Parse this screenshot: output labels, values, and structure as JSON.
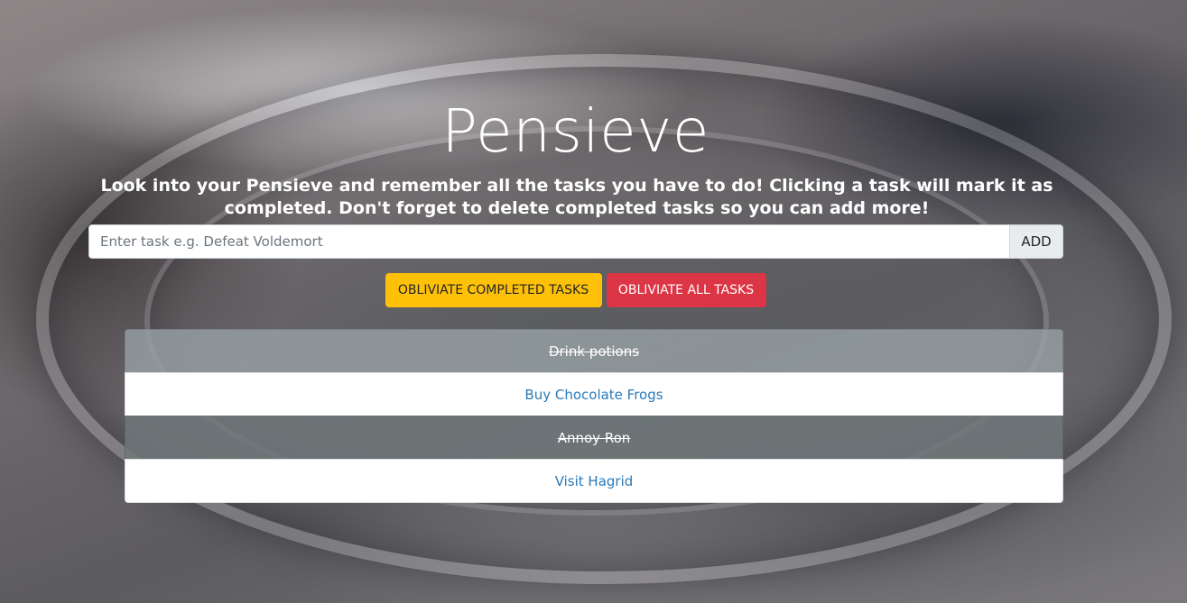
{
  "header": {
    "title": "Pensieve",
    "subtitle": "Look into your Pensieve and remember all the tasks you have to do! Clicking a task will mark it as completed. Don't forget to delete completed tasks so you can add more!"
  },
  "task_form": {
    "placeholder": "Enter task e.g. Defeat Voldemort",
    "value": "",
    "add_label": "ADD"
  },
  "actions": {
    "clear_completed_label": "OBLIVIATE COMPLETED TASKS",
    "clear_all_label": "OBLIVIATE ALL TASKS"
  },
  "colors": {
    "warning": "#ffc107",
    "danger": "#dc3545",
    "link": "#2a7ab8"
  },
  "tasks": [
    {
      "label": "Drink potions",
      "completed": true
    },
    {
      "label": "Buy Chocolate Frogs",
      "completed": false
    },
    {
      "label": "Annoy Ron",
      "completed": true
    },
    {
      "label": "Visit Hagrid",
      "completed": false
    }
  ]
}
